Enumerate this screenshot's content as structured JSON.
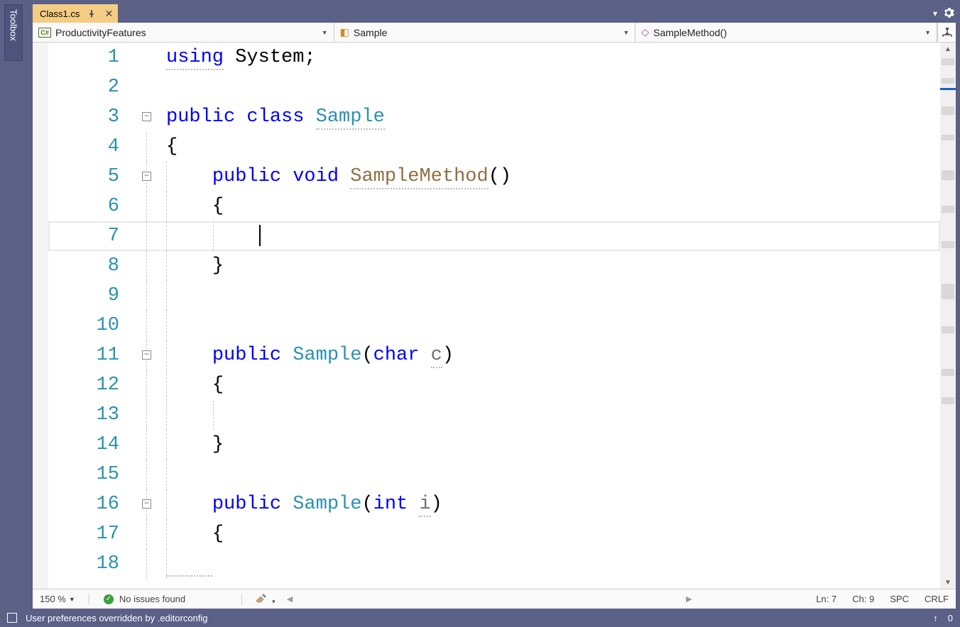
{
  "toolbox": {
    "label": "Toolbox"
  },
  "tab": {
    "filename": "Class1.cs"
  },
  "nav": {
    "project": "ProductivityFeatures",
    "class": "Sample",
    "method": "SampleMethod()"
  },
  "zoom": "150 %",
  "issues": "No issues found",
  "editor_status": {
    "ln": "Ln: 7",
    "ch": "Ch: 9",
    "spc": "SPC",
    "crlf": "CRLF"
  },
  "app_status": {
    "message": "User preferences overridden by .editorconfig",
    "count": "0"
  },
  "code": {
    "l1_using": "using",
    "l1_rest": " System;",
    "l3_pub": "public",
    "l3_class": " class ",
    "l3_name": "Sample",
    "l4": "{",
    "l5_pub": "public",
    "l5_void": " void ",
    "l5_name": "SampleMethod",
    "l5_paren": "()",
    "l6": "{",
    "l8": "}",
    "l11_pub": "public",
    "l11_sp": " ",
    "l11_name": "Sample",
    "l11_p1": "(",
    "l11_char": "char",
    "l11_sp2": " ",
    "l11_c": "c",
    "l11_p2": ")",
    "l12": "{",
    "l14": "}",
    "l16_pub": "public",
    "l16_sp": " ",
    "l16_name": "Sample",
    "l16_p1": "(",
    "l16_int": "int",
    "l16_sp2": " ",
    "l16_i": "i",
    "l16_p2": ")",
    "l17": "{"
  },
  "line_numbers": [
    "1",
    "2",
    "3",
    "4",
    "5",
    "6",
    "7",
    "8",
    "9",
    "10",
    "11",
    "12",
    "13",
    "14",
    "15",
    "16",
    "17",
    "18"
  ]
}
